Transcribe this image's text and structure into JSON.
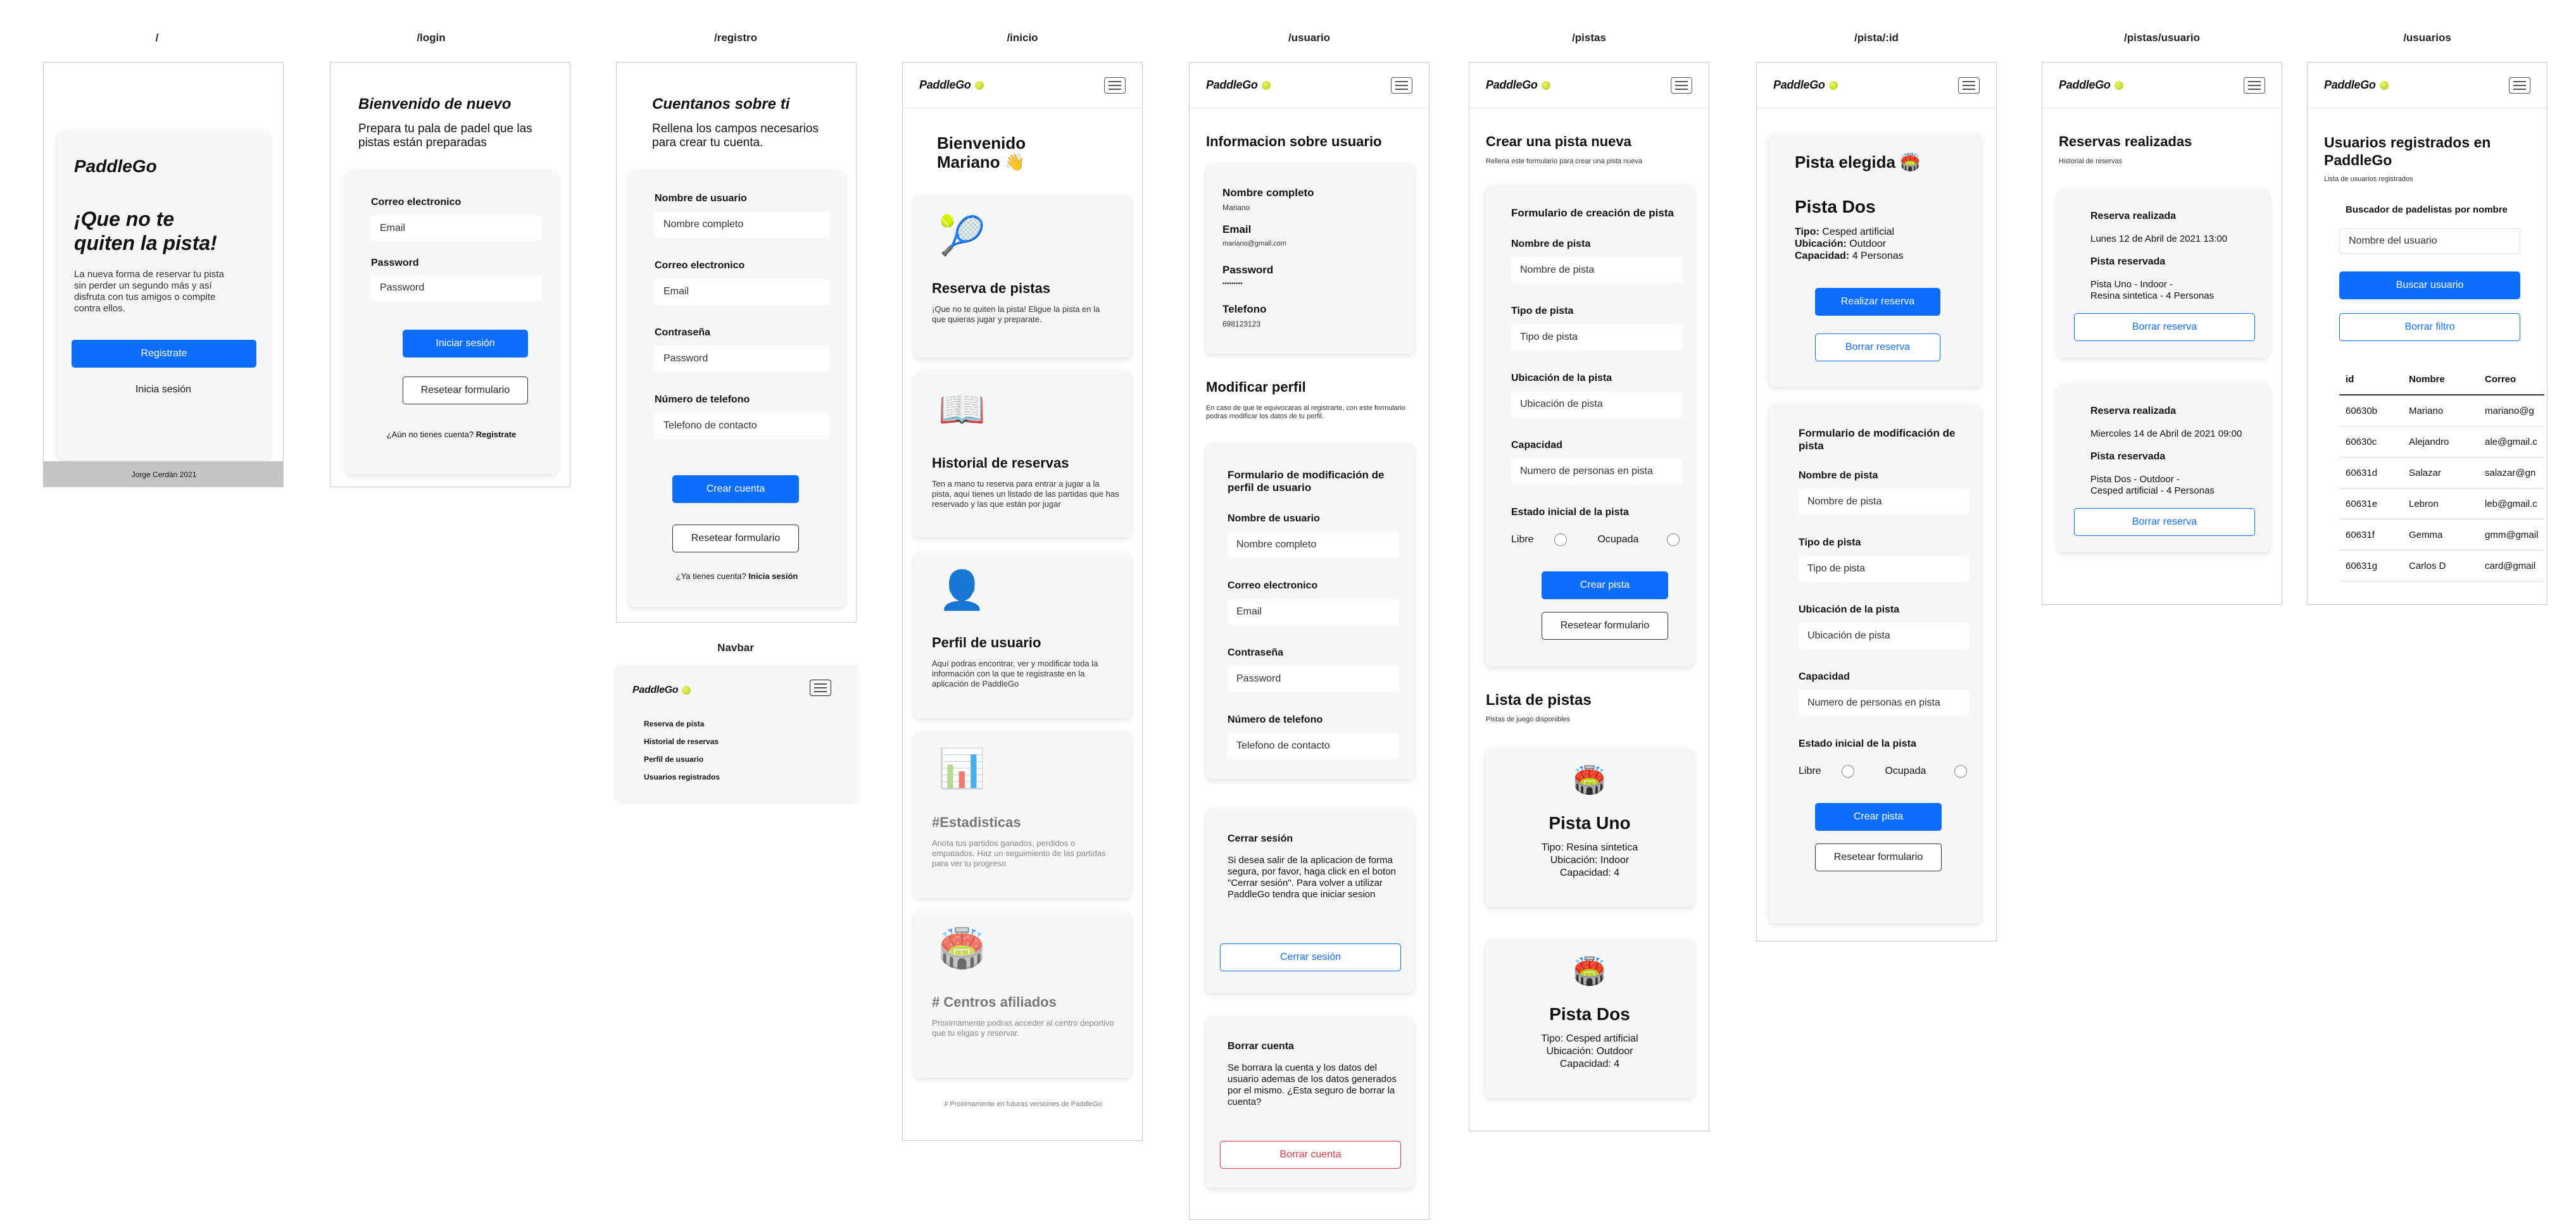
{
  "routes": {
    "landing": "/",
    "login": "/login",
    "registro": "/registro",
    "inicio": "/inicio",
    "usuario": "/usuario",
    "pistas": "/pistas",
    "pista_id": "/pista/:id",
    "pistas_usuario": "/pistas/usuario",
    "usuarios": "/usuarios",
    "navbar": "Navbar"
  },
  "brand": "PaddleGo",
  "colors": {
    "primary": "#0d6efd",
    "danger": "#dc3545",
    "card": "#f6f7f8",
    "footer": "#c4c4c4"
  },
  "landing": {
    "brand": "PaddleGo",
    "headline": "¡Que no te quiten la pista!",
    "description": "La nueva forma de reservar tu pista sin perder un segundo más y así disfruta con tus amigos o compite contra ellos.",
    "register_button": "Registrate",
    "login_link": "Inicia sesión",
    "footer": "Jorge Cerdán 2021"
  },
  "login": {
    "title": "Bienvenido de nuevo",
    "subtitle": "Prepara tu pala de padel que las pistas están preparadas",
    "email_label": "Correo electronico",
    "email_placeholder": "Email",
    "password_label": "Password",
    "password_placeholder": "Password",
    "submit": "Iniciar sesión",
    "reset": "Resetear formulario",
    "no_account": "¿Aún no tienes cuenta?",
    "register_link": "Registrate"
  },
  "registro": {
    "title": "Cuentanos sobre ti",
    "subtitle": "Rellena los campos necesarios para crear tu cuenta.",
    "fields": [
      {
        "label": "Nombre de usuario",
        "placeholder": "Nombre completo"
      },
      {
        "label": "Correo electronico",
        "placeholder": "Email"
      },
      {
        "label": "Contraseña",
        "placeholder": "Password"
      },
      {
        "label": "Número de telefono",
        "placeholder": "Telefono de contacto"
      }
    ],
    "submit": "Crear cuenta",
    "reset": "Resetear formulario",
    "has_account": "¿Ya tienes cuenta?",
    "login_link": "Inicia sesión"
  },
  "navbar_menu": {
    "items": [
      "Reserva de pista",
      "Historial de reservas",
      "Perfil de usuario",
      "Usuarios registrados"
    ]
  },
  "inicio": {
    "welcome": "Bienvenido",
    "name": "Mariano 👋",
    "cards": [
      {
        "icon": "tennis-ball-icon",
        "emoji": "🎾",
        "title": "Reserva de pistas",
        "text": "¡Que no te quiten la pista! Eligue la pista en la que quieras jugar y preparate."
      },
      {
        "icon": "book-icon",
        "emoji": "📖",
        "title": "Historial de reservas",
        "text": "Ten a mano tu reserva para entrar a jugar a la pista, aquí tienes un listado de las partidas que has reservado y las que están por jugar"
      },
      {
        "icon": "user-silhouette-icon",
        "emoji": "👤",
        "title": "Perfil de usuario",
        "text": "Aquí podras encontrar, ver y modificar toda la información con la que te registraste en la aplicación de PaddleGo"
      },
      {
        "icon": "bar-chart-icon",
        "emoji": "📊",
        "title": "#Estadisticas",
        "text": "Anota tus partidos ganados, perdidos o empatados. Haz un seguimiento de las partidas para ver tu progreso"
      },
      {
        "icon": "stadium-icon",
        "emoji": "🏟️",
        "title": "# Centros afiliados",
        "text": "Proximamente podras acceder al centro deportivo que tu eligas y reservar."
      }
    ],
    "footnote": "# Proximamente en futuras versiones de PaddleGo"
  },
  "usuario": {
    "info_title": "Informacion sobre usuario",
    "info": [
      {
        "label": "Nombre completo",
        "value": "Mariano"
      },
      {
        "label": "Email",
        "value": "mariano@gmail.com"
      },
      {
        "label": "Password",
        "value": "•••••••••"
      },
      {
        "label": "Telefono",
        "value": "698123123"
      }
    ],
    "modify_title": "Modificar perfil",
    "modify_subtitle": "En caso de que te equivocaras al registrarte, con este formulario podras modificar los datos de tu perfil.",
    "form_title": "Formulario de modificación de perfil de usuario",
    "fields": [
      {
        "label": "Nombre de usuario",
        "placeholder": "Nombre completo"
      },
      {
        "label": "Correo electronico",
        "placeholder": "Email"
      },
      {
        "label": "Contraseña",
        "placeholder": "Password"
      },
      {
        "label": "Número de telefono",
        "placeholder": "Telefono de contacto"
      }
    ],
    "logout_title": "Cerrar sesión",
    "logout_text": "Si desea salir de la aplicacion de forma segura, por favor, haga click en el boton \"Cerrar sesión\". Para volver a utilizar PaddleGo tendra que iniciar sesion",
    "logout_button": "Cerrar sesión",
    "delete_title": "Borrar cuenta",
    "delete_text": "Se borrara la cuenta y los datos del usuario ademas de los datos generados por el mismo. ¿Esta seguro de borrar la cuenta?",
    "delete_button": "Borrar cuenta"
  },
  "pistas": {
    "title": "Crear una pista nueva",
    "subtitle": "Rellena este formulario para crear una pista nueva",
    "form_title": "Formulario de creación de pista",
    "fields": [
      {
        "label": "Nombre de pista",
        "placeholder": "Nombre de pista"
      },
      {
        "label": "Tipo de pista",
        "placeholder": "Tipo de pista"
      },
      {
        "label": "Ubicación de la pista",
        "placeholder": "Ubicación de pista"
      },
      {
        "label": "Capacidad",
        "placeholder": "Numero de personas en pista"
      }
    ],
    "estado_label": "Estado inicial de la pista",
    "libre": "Libre",
    "ocupada": "Ocupada",
    "submit": "Crear pista",
    "reset": "Resetear formulario",
    "list_title": "Lista de pistas",
    "list_subtitle": "Pistas de juego disponibles",
    "courts": [
      {
        "emoji": "🏟️",
        "name": "Pista Uno",
        "tipo": "Tipo: Resina sintetica",
        "ubicacion": "Ubicación: Indoor",
        "capacidad": "Capacidad: 4"
      },
      {
        "emoji": "🏟️",
        "name": "Pista Dos",
        "tipo": "Tipo: Cesped artificial",
        "ubicacion": "Ubicación: Outdoor",
        "capacidad": "Capacidad: 4"
      }
    ]
  },
  "pista_id": {
    "title": "Pista elegida 🏟️",
    "name": "Pista Dos",
    "tipo_label": "Tipo:",
    "tipo": "Cesped artificial",
    "ubicacion_label": "Ubicación:",
    "ubicacion": "Outdoor",
    "capacidad_label": "Capacidad:",
    "capacidad": "4 Personas",
    "reserve_button": "Realizar reserva",
    "delete_button": "Borrar reserva",
    "form_title": "Formulario de modificación de pista",
    "fields": [
      {
        "label": "Nombre de pista",
        "placeholder": "Nombre de pista"
      },
      {
        "label": "Tipo de pista",
        "placeholder": "Tipo de pista"
      },
      {
        "label": "Ubicación de la pista",
        "placeholder": "Ubicación de pista"
      },
      {
        "label": "Capacidad",
        "placeholder": "Numero de personas en pista"
      }
    ],
    "estado_label": "Estado inicial de la pista",
    "libre": "Libre",
    "ocupada": "Ocupada",
    "submit": "Crear pista",
    "reset": "Resetear formulario"
  },
  "pistas_usuario": {
    "title": "Reservas realizadas",
    "subtitle": "Historial de reservas",
    "reservas": [
      {
        "title": "Reserva realizada",
        "date": "Lunes 12 de Abril de 2021 13:00",
        "pista_label": "Pista reservada",
        "detail1": "Pista Uno - Indoor -",
        "detail2": "Resina sintetica - 4 Personas",
        "button": "Borrar reserva"
      },
      {
        "title": "Reserva realizada",
        "date": "Miercoles 14 de Abril de 2021 09:00",
        "pista_label": "Pista reservada",
        "detail1": "Pista Dos - Outdoor -",
        "detail2": "Cesped artificial - 4 Personas",
        "button": "Borrar reserva"
      }
    ]
  },
  "usuarios": {
    "title": "Usuarios registrados en PaddleGo",
    "subtitle": "Lista de usuarios registrados",
    "search_label": "Buscador de padelistas por nombre",
    "search_placeholder": "Nombre del usuario",
    "search_button": "Buscar usuario",
    "clear_button": "Borrar filtro",
    "columns": [
      "id",
      "Nombre",
      "Correo"
    ],
    "rows": [
      [
        "60630b",
        "Mariano",
        "mariano@g"
      ],
      [
        "60630c",
        "Alejandro",
        "ale@gmail.c"
      ],
      [
        "60631d",
        "Salazar",
        "salazar@gn"
      ],
      [
        "60631e",
        "Lebron",
        "leb@gmail.c"
      ],
      [
        "60631f",
        "Gemma",
        "gmm@gmail"
      ],
      [
        "60631g",
        "Carlos D",
        "card@gmail"
      ]
    ]
  }
}
